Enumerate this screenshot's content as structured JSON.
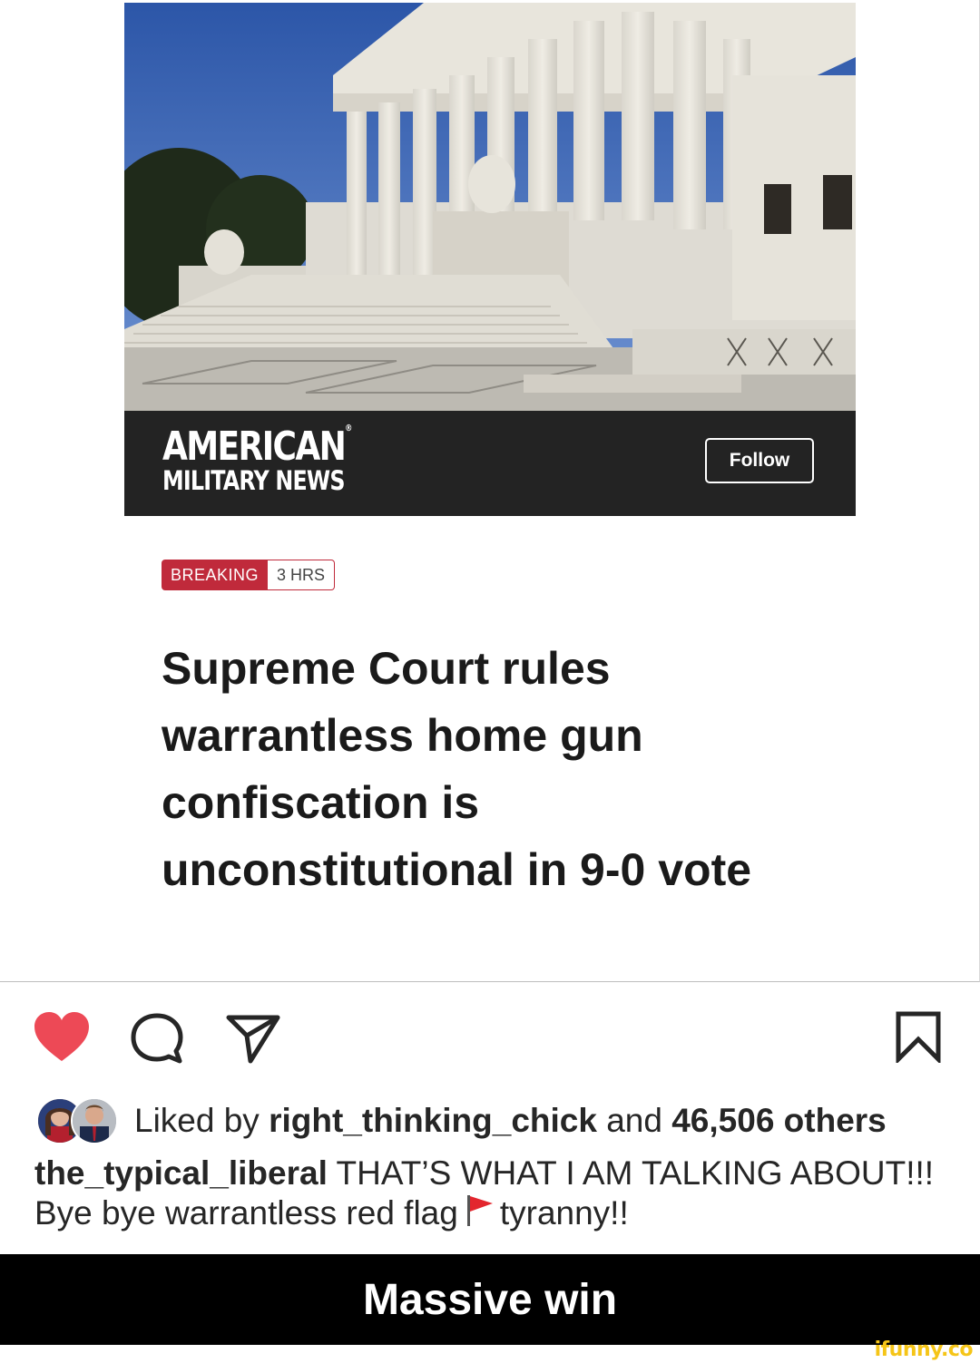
{
  "article_card": {
    "publisher": {
      "line1": "AMERICAN",
      "line2": "MILITARY NEWS",
      "registered_mark": "®",
      "follow_label": "Follow"
    },
    "badge": {
      "label": "BREAKING",
      "age": "3 HRS",
      "color": "#c02a3b"
    },
    "headline": "Supreme Court rules warrantless home gun confiscation is unconstitutional in 9-0 vote"
  },
  "actions": {
    "icons": [
      "heart-icon",
      "comment-icon",
      "share-icon",
      "bookmark-icon"
    ],
    "heart_color": "#ed4956"
  },
  "likes": {
    "prefix": "Liked by",
    "user": "right_thinking_chick",
    "conjunction": "and",
    "others": "46,506 others"
  },
  "caption": {
    "username": "the_typical_liberal",
    "text_before_flag": "THAT’S WHAT I AM TALKING ABOUT!!! Bye bye warrantless red flag",
    "text_after_flag": "tyranny!!"
  },
  "footer": {
    "title": "Massive win"
  },
  "watermark": "ifunny.co"
}
